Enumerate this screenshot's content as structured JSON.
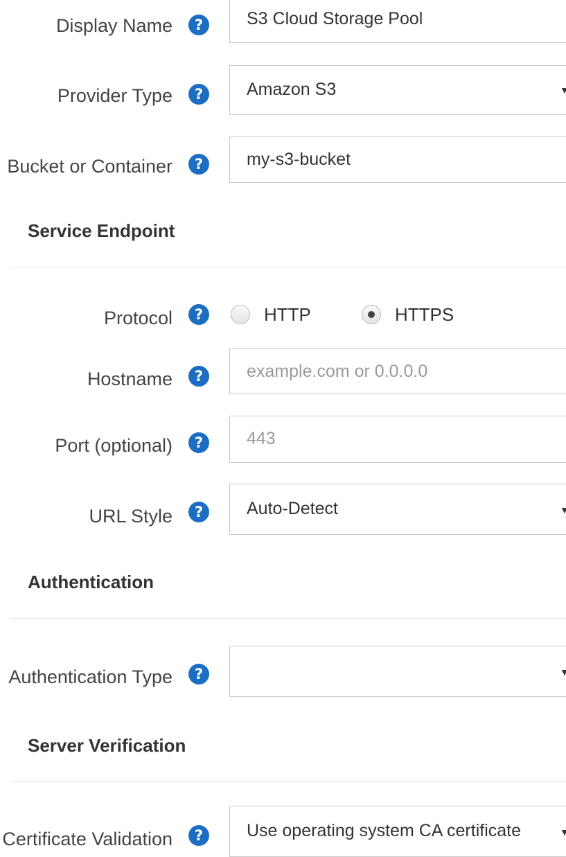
{
  "form": {
    "display_name": {
      "label": "Display Name",
      "help_icon": "question-circle-icon",
      "value": "S3 Cloud Storage Pool"
    },
    "provider_type": {
      "label": "Provider Type",
      "help_icon": "question-circle-icon",
      "value": "Amazon S3"
    },
    "bucket": {
      "label": "Bucket or Container",
      "help_icon": "question-circle-icon",
      "value": "my-s3-bucket"
    }
  },
  "sections": {
    "service_endpoint": "Service Endpoint",
    "authentication": "Authentication",
    "server_verification": "Server Verification"
  },
  "endpoint": {
    "protocol": {
      "label": "Protocol",
      "options": [
        "HTTP",
        "HTTPS"
      ],
      "selected": "HTTPS"
    },
    "hostname": {
      "label": "Hostname",
      "value": "",
      "placeholder": "example.com or 0.0.0.0"
    },
    "port": {
      "label": "Port (optional)",
      "value": "",
      "placeholder": "443"
    },
    "url_style": {
      "label": "URL Style",
      "value": "Auto-Detect"
    }
  },
  "auth": {
    "type": {
      "label": "Authentication Type",
      "value": ""
    }
  },
  "verification": {
    "certificate_validation": {
      "label": "Certificate Validation",
      "value": "Use operating system CA certificate"
    }
  },
  "icons": {
    "help": "?",
    "dropdown": "▼"
  },
  "colors": {
    "help_icon": "#1c6ec2",
    "border": "#c9c9c9",
    "placeholder": "#9a9a9a"
  }
}
